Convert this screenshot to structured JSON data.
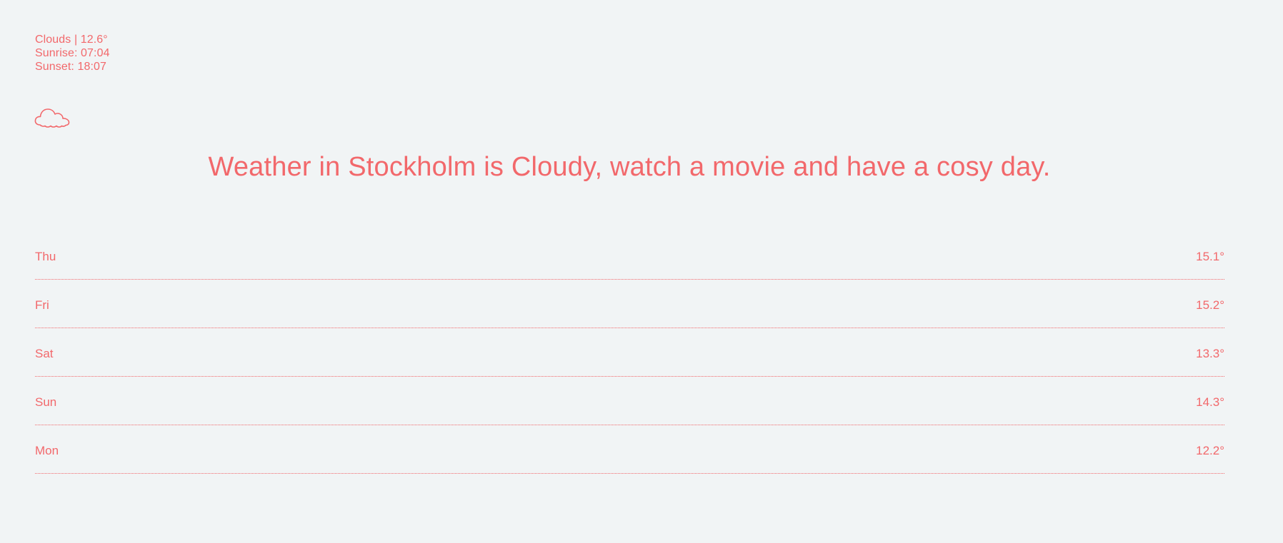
{
  "current": {
    "condition_line": "Clouds | 12.6°",
    "sunrise": "Sunrise: 07:04",
    "sunset": "Sunset: 18:07",
    "icon": "cloud-icon"
  },
  "headline": "Weather in Stockholm is Cloudy, watch a movie and have a cosy day.",
  "forecast": [
    {
      "day": "Thu",
      "temp": "15.1°"
    },
    {
      "day": "Fri",
      "temp": "15.2°"
    },
    {
      "day": "Sat",
      "temp": "13.3°"
    },
    {
      "day": "Sun",
      "temp": "14.3°"
    },
    {
      "day": "Mon",
      "temp": "12.2°"
    }
  ],
  "colors": {
    "accent": "#f2686b",
    "background": "#f1f4f5"
  }
}
